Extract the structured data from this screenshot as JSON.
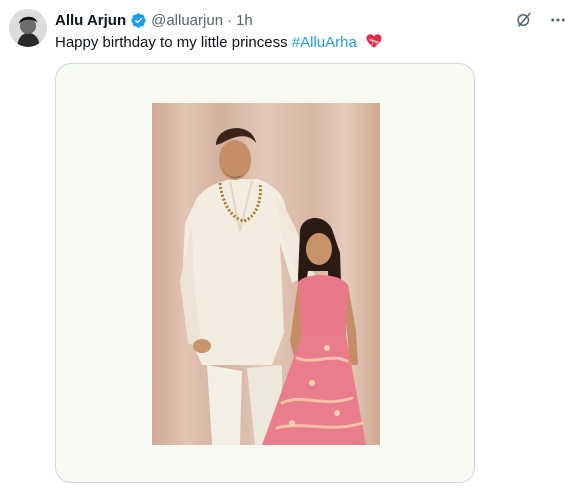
{
  "tweet": {
    "author_name": "Allu Arjun",
    "handle": "@alluarjun",
    "separator": "·",
    "time": "1h",
    "text_before": "Happy birthday to my little princess",
    "hashtag": "#AlluArha",
    "emoji_icon": "heart-with-ribbon-icon"
  },
  "icons": {
    "verified": "verified-badge-icon",
    "grok": "grok-icon",
    "more": "more-icon"
  },
  "colors": {
    "accent": "#1d9bf0",
    "text": "#0f1419",
    "muted": "#536471",
    "photo_backdrop": "#d9b9a6",
    "dress": "#e9788a",
    "sherwani": "#f3ece0"
  }
}
